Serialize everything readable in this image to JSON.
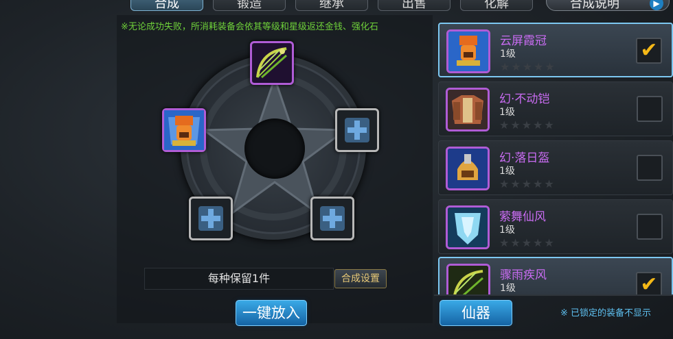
{
  "tabs": [
    {
      "label": "合成",
      "active": true
    },
    {
      "label": "锻造",
      "active": false
    },
    {
      "label": "继承",
      "active": false
    },
    {
      "label": "出售",
      "active": false
    },
    {
      "label": "化解",
      "active": false
    }
  ],
  "help_tab": {
    "label": "合成说明",
    "icon": "arrow-right-icon"
  },
  "notice": "※无论成功失败，所消耗装备会依其等级和星级返还金钱、强化石",
  "slots": [
    {
      "position": "top",
      "state": "filled",
      "item_icon": "bow-icon"
    },
    {
      "position": "left",
      "state": "filled",
      "item_icon": "crown-helmet-icon"
    },
    {
      "position": "right",
      "state": "empty",
      "item_icon": "plus-icon"
    },
    {
      "position": "bottom-left",
      "state": "empty",
      "item_icon": "plus-icon"
    },
    {
      "position": "bottom-right",
      "state": "empty",
      "item_icon": "plus-icon"
    }
  ],
  "keep_bar": {
    "label": "每种保留1件"
  },
  "synth_settings_button": "合成设置",
  "auto_fill_button": "一键放入",
  "category_button": "仙器",
  "footer_note": "※ 已锁定的装备不显示",
  "items": [
    {
      "name": "云屏霞冠",
      "level": "1级",
      "stars": 5,
      "checked": true,
      "selected": true,
      "icon": "crown-helmet-icon"
    },
    {
      "name": "幻·不动铠",
      "level": "1级",
      "stars": 5,
      "checked": false,
      "selected": false,
      "icon": "armor-icon"
    },
    {
      "name": "幻·落日盔",
      "level": "1级",
      "stars": 5,
      "checked": false,
      "selected": false,
      "icon": "helmet-icon"
    },
    {
      "name": "萦舞仙风",
      "level": "1级",
      "stars": 5,
      "checked": false,
      "selected": false,
      "icon": "shield-icon"
    },
    {
      "name": "骤雨疾风",
      "level": "1级",
      "stars": 5,
      "checked": true,
      "selected": true,
      "icon": "bow-icon"
    }
  ],
  "colors": {
    "item_name": "#c96cf2",
    "notice": "#6fd13a",
    "checkmark": "#f4b817",
    "accent_blue": "#1e7fc1"
  }
}
